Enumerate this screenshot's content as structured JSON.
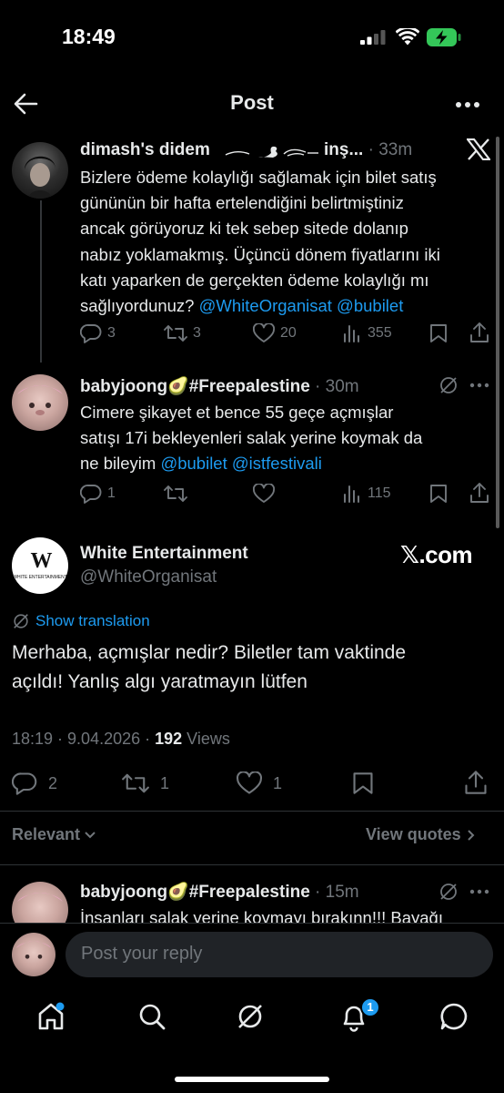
{
  "status_bar": {
    "time": "18:49",
    "battery_charging": true
  },
  "header": {
    "title": "Post",
    "back_icon": "arrow-left-icon",
    "more_icon": "more-icon"
  },
  "tweet1": {
    "name": "dimash's didem",
    "name_suffix": "inş...",
    "time": "33m",
    "text_lines": [
      "Bizlere ödeme kolaylığı sağlamak için bilet satış",
      "gününün bir hafta ertelendiğini belirtmiştiniz",
      "ancak görüyoruz ki tek sebep sitede dolanıp",
      "nabız yoklamakmış. Üçüncü dönem fiyatlarını iki",
      "katı yaparken de gerçekten ödeme kolaylığı mı"
    ],
    "last_line_text": "sağlıyordunuz?",
    "mention1": "@WhiteOrganisat",
    "mention2": "@bubilet",
    "stats": {
      "replies": "3",
      "reposts": "3",
      "likes": "20",
      "views": "355"
    }
  },
  "tweet2": {
    "name": "babyjoong🥑#Freepalestine",
    "time": "30m",
    "text_lines": [
      "Cimere şikayet et bence 55 geçe açmışlar",
      "satışı 17i bekleyenleri salak yerine koymak da"
    ],
    "last_line_text": "ne bileyim",
    "mention1": "@bubilet",
    "mention2": "@istfestivali",
    "stats": {
      "replies": "1",
      "reposts": "",
      "likes": "",
      "views": "115"
    }
  },
  "main_tweet": {
    "name": "White Entertainment",
    "handle": "@WhiteOrganisat",
    "avatar_logo": "W",
    "avatar_caption": "WHITE ENTERTAINMENT",
    "watermark": "𝕏.com",
    "translate_label": "Show translation",
    "text_lines": [
      "Merhaba, açmışlar nedir? Biletler tam vaktinde",
      "açıldı! Yanlış algı yaratmayın lütfen"
    ],
    "meta_time": "18:19 · 9.04.2026 · ",
    "views_count": "192",
    "views_label": " Views",
    "stats": {
      "replies": "2",
      "reposts": "1",
      "likes": "1"
    }
  },
  "sort": {
    "relevant": "Relevant",
    "view_quotes": "View quotes"
  },
  "reply1": {
    "name": "babyjoong🥑#Freepalestine",
    "time": "15m",
    "text": "İnsanları salak yerine koymayı bırakınn!!! Bayağı"
  },
  "reply_box": {
    "placeholder": "Post your reply"
  },
  "nav": {
    "notifications_badge": "1"
  },
  "colors": {
    "background": "#000000",
    "text": "#e7e9ea",
    "muted": "#71767b",
    "accent": "#1d9bf0",
    "battery": "#34c759"
  }
}
